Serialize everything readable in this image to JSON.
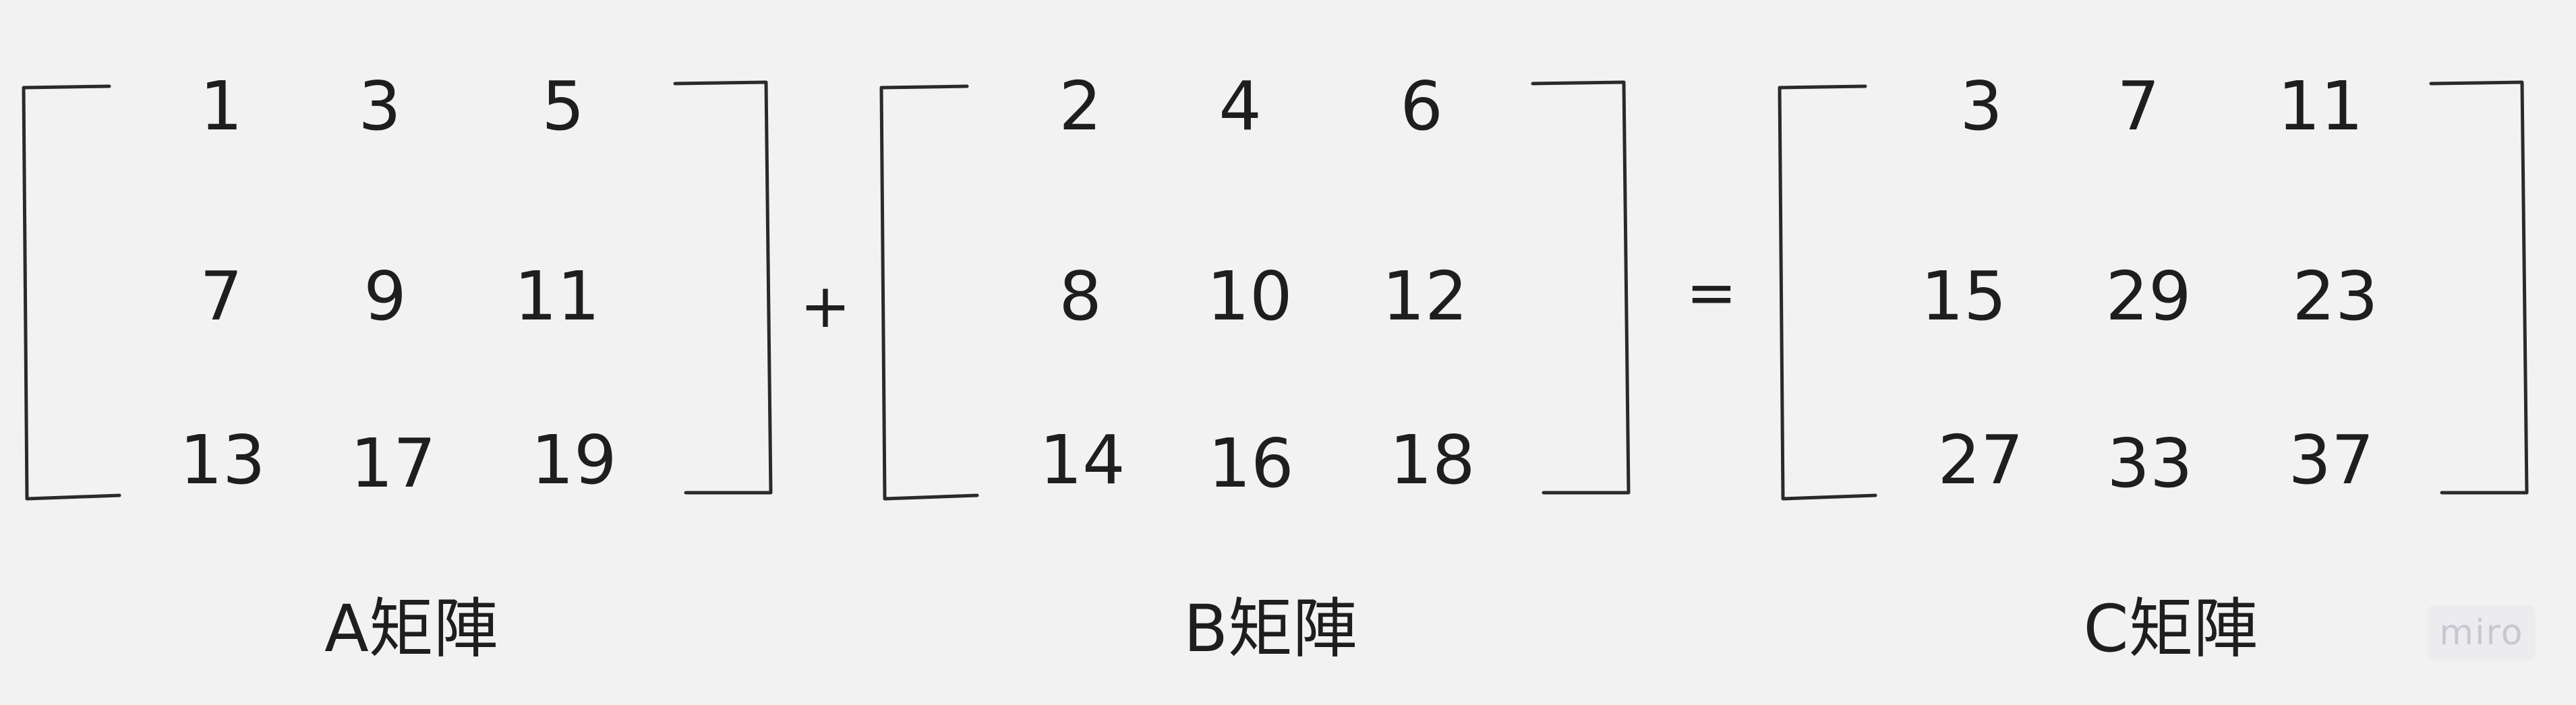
{
  "matrices": [
    {
      "name": "A",
      "rows": [
        [
          "1",
          "3",
          "5"
        ],
        [
          "7",
          "9",
          "11"
        ],
        [
          "13",
          "17",
          "19"
        ]
      ],
      "label": "A矩陣"
    },
    {
      "name": "B",
      "rows": [
        [
          "2",
          "4",
          "6"
        ],
        [
          "8",
          "10",
          "12"
        ],
        [
          "14",
          "16",
          "18"
        ]
      ],
      "label": "B矩陣"
    },
    {
      "name": "C",
      "rows": [
        [
          "3",
          "7",
          "11"
        ],
        [
          "15",
          "29",
          "23"
        ],
        [
          "27",
          "33",
          "37"
        ]
      ],
      "label": "C矩陣"
    }
  ],
  "operators": {
    "plus": "+",
    "equals": "="
  },
  "watermark": "miro"
}
